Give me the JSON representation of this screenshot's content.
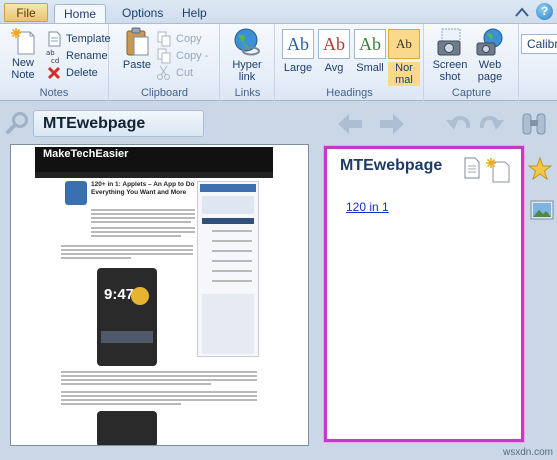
{
  "tabs": {
    "file": "File",
    "home": "Home",
    "options": "Options",
    "help": "Help"
  },
  "ribbon": {
    "notes": {
      "label": "Notes",
      "new_note": "New\nNote",
      "template": "Template",
      "rename": "Rename",
      "delete": "Delete"
    },
    "clipboard": {
      "label": "Clipboard",
      "paste": "Paste",
      "copy": "Copy",
      "copy_dash": "Copy -",
      "cut": "Cut"
    },
    "links": {
      "label": "Links",
      "hyperlink": "Hyper\nlink"
    },
    "headings": {
      "label": "Headings",
      "large": "Large",
      "avg": "Avg",
      "small": "Small",
      "normal": "Nor\nmal",
      "sample": "Ab"
    },
    "capture": {
      "label": "Capture",
      "screenshot": "Screen\nshot",
      "webpage": "Web\npage"
    },
    "font": "Calibri"
  },
  "toolbar": {
    "note_title": "MTEwebpage"
  },
  "note": {
    "title": "MTEwebpage",
    "link": "120 in 1"
  },
  "webpage": {
    "logo": "MakeTechEasier",
    "article_title": "120+ in 1: Applets – An App to Do Everything You Want and More",
    "clock": "9:47"
  },
  "watermark": "wsxdn.com",
  "colors": {
    "note_border": "#c837c8",
    "link": "#1a2ec8",
    "accent": "#2c7dc8"
  }
}
